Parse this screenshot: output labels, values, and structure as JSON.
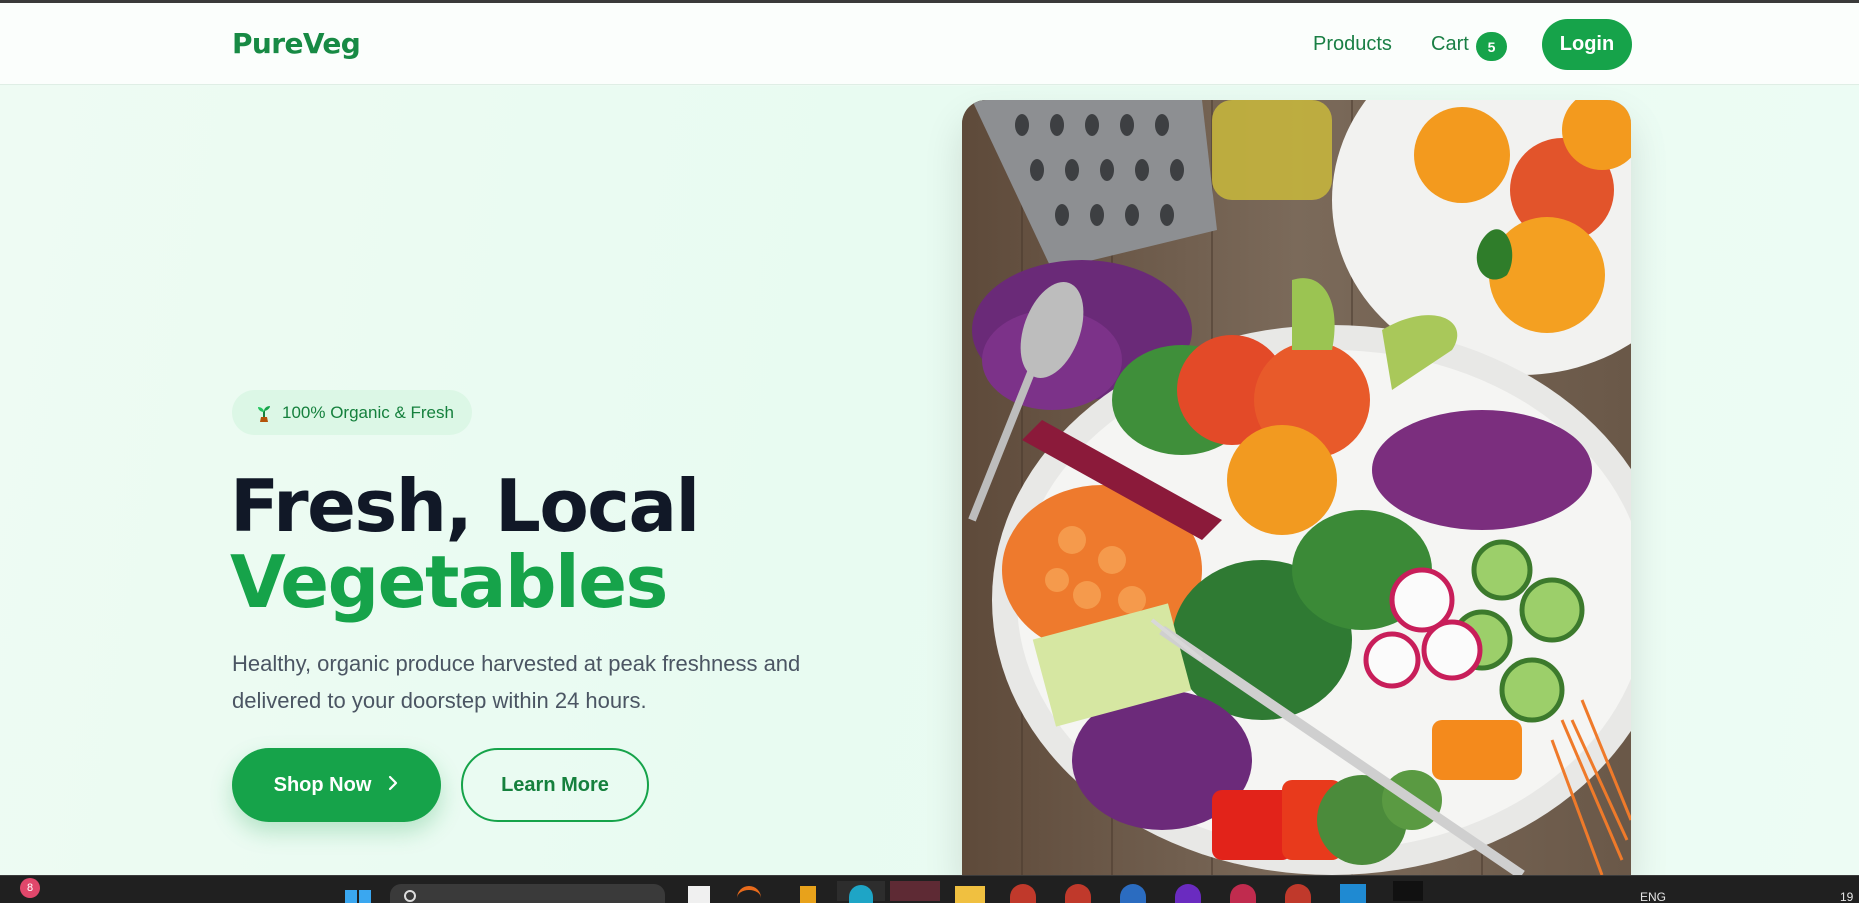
{
  "brand": "PureVeg",
  "nav": {
    "products_label": "Products",
    "cart_label": "Cart",
    "cart_count": "5",
    "login_label": "Login"
  },
  "hero": {
    "badge_text": "100% Organic & Fresh",
    "headline_line1": "Fresh, Local",
    "headline_line2": "Vegetables",
    "description": "Healthy, organic produce harvested at peak freshness and delivered to your doorstep within 24 hours.",
    "shop_button_label": "Shop Now",
    "learn_button_label": "Learn More",
    "image_alt": "salad-bowl-photo"
  },
  "taskbar": {
    "notification_count": "8",
    "language": "ENG",
    "clock_fragment": "19"
  },
  "colors": {
    "brand_green": "#16a34a",
    "dark_text": "#111827",
    "hero_bg": "#edfbf3"
  }
}
